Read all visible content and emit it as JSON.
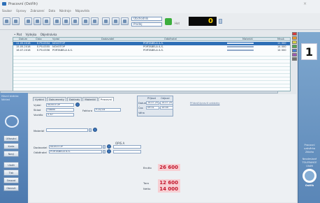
{
  "window": {
    "title": "Pracovní (Ostřih)",
    "close": "×"
  },
  "menu": [
    "Soubor",
    "Úpravy",
    "Zobrazení",
    "Data",
    "Nástroje",
    "Nápověda"
  ],
  "toolbar": {
    "combo1": "Obchodník",
    "combo2": "Prodej",
    "state_label": "Hot",
    "counter": "0"
  },
  "docbar": {
    "items": [
      "• Plat",
      "Výdejka",
      "Objednávka"
    ]
  },
  "grid": {
    "headers": [
      "Datum",
      "Číslo",
      "Vydal",
      "Dodavatel",
      "Odběratel",
      "Materiál",
      "Množ."
    ],
    "rows": [
      {
        "date": "11.05.2018",
        "num": "E.P0.0354",
        "who": "NOVOTOP",
        "supplier": "",
        "customer": "PORTABELA A.S.",
        "qty": "11 000"
      },
      {
        "date": "15.05.2018",
        "num": "E.P0.0355",
        "who": "NOVOTOP",
        "supplier": "",
        "customer": "PORTABELA A.S.",
        "qty": "14 000"
      },
      {
        "date": "16.07.2018",
        "num": "E.P0.0356",
        "who": "PORTABELA A.S.",
        "supplier": "",
        "customer": "PORTABELA A.S.",
        "qty": "14 000"
      }
    ]
  },
  "legend_colors": [
    "#d93c3c",
    "#e79a2b",
    "#d9d14a",
    "#4fa84f",
    "#4a7fd1",
    "#9b59b6",
    "#707070"
  ],
  "right_panel": {
    "badge": "1",
    "note1": "Pracovní",
    "note2": "uzávěrka",
    "note3": "Záloha",
    "note4": "Neodeslané",
    "note5": "TOLERANCE",
    "note6": "Uložit",
    "logo_text": "Ostřih"
  },
  "left_nav": {
    "caption": "Hlavní stránka  Náhled",
    "buttons": [
      "Účtování",
      "Karta",
      "Nový",
      "Uložit",
      "Tisk",
      "Smazat",
      "Obnovit"
    ]
  },
  "form": {
    "tabs": [
      "Vydání",
      "Dokumenty",
      "Doklady",
      "Materiál",
      "Pracovní"
    ],
    "fields": {
      "vydal_label": "Vydal",
      "vydal_value": "NOVOTOP",
      "sklad_label": "Sklad",
      "sklad_value": "Hlavní",
      "vozidlo_label": "Vozidlo",
      "vozidlo_value": "5 A7",
      "faktura_label": "Faktura",
      "faktura_value": "P.10/18",
      "material_label": "Materiál",
      "opis_label": "OPIS A",
      "dodavatel_label": "Dodavatel",
      "dodavatel_value": "NOVOTOP",
      "odberatel_label": "Odběratel",
      "odberatel_value": "PORTABELA A.S."
    },
    "datebox": {
      "col1": "Příjezd",
      "col2": "Odjezd",
      "row1": "Datum",
      "row2": "Čas",
      "row3": "Váha",
      "d1": "14.07.2018",
      "d2": "14.07.2018",
      "t1": "09:01",
      "t2": "10:04"
    },
    "link": "Přidat/Upravit zakázky"
  },
  "totals": {
    "brutto_label": "Brutto",
    "brutto": "26 600",
    "tara_label": "Tara",
    "tara": "12 600",
    "netto_label": "Netto",
    "netto": "14 000"
  }
}
